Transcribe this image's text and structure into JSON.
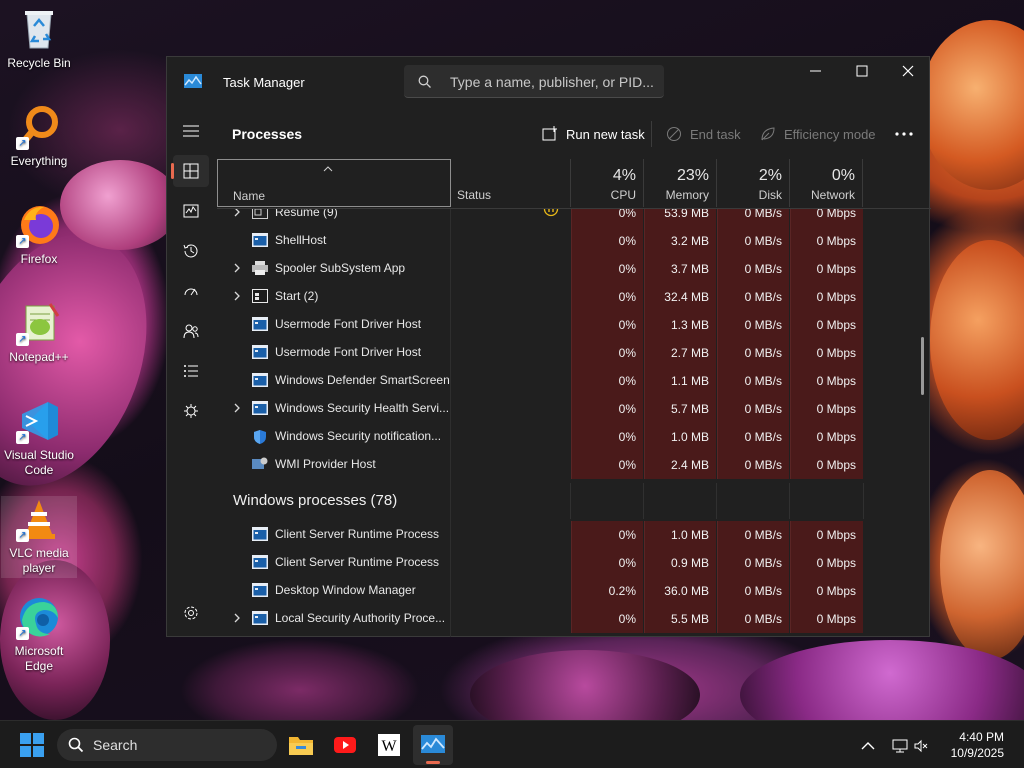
{
  "desktop": {
    "icons": [
      {
        "label": "Recycle Bin",
        "icon": "recycle-bin-icon"
      },
      {
        "label": "Everything",
        "icon": "everything-search-icon"
      },
      {
        "label": "Firefox",
        "icon": "firefox-icon"
      },
      {
        "label": "Notepad++",
        "icon": "notepadpp-icon"
      },
      {
        "label": "Visual Studio Code",
        "icon": "vscode-icon"
      },
      {
        "label": "VLC media player",
        "icon": "vlc-icon"
      },
      {
        "label": "Microsoft Edge",
        "icon": "edge-icon"
      }
    ]
  },
  "window": {
    "title": "Task Manager",
    "search_placeholder": "Type a name, publisher, or PID...",
    "controls": [
      "minimize",
      "maximize",
      "close"
    ]
  },
  "nav": {
    "items": [
      {
        "name": "menu",
        "icon": "hamburger-icon"
      },
      {
        "name": "processes",
        "icon": "processes-icon",
        "active": true
      },
      {
        "name": "performance",
        "icon": "performance-icon"
      },
      {
        "name": "app-history",
        "icon": "history-icon"
      },
      {
        "name": "startup-apps",
        "icon": "startup-icon"
      },
      {
        "name": "users",
        "icon": "users-icon"
      },
      {
        "name": "details",
        "icon": "details-icon"
      },
      {
        "name": "services",
        "icon": "services-icon"
      },
      {
        "name": "settings",
        "icon": "settings-icon"
      }
    ]
  },
  "toolbar": {
    "page_title": "Processes",
    "run_new_task": "Run new task",
    "end_task": "End task",
    "efficiency_mode": "Efficiency mode",
    "more": "..."
  },
  "columns": {
    "name": "Name",
    "status": "Status",
    "cpu": {
      "pct": "4%",
      "label": "CPU"
    },
    "memory": {
      "pct": "23%",
      "label": "Memory"
    },
    "disk": {
      "pct": "2%",
      "label": "Disk"
    },
    "network": {
      "pct": "0%",
      "label": "Network"
    }
  },
  "rows": [
    {
      "name": "Resume (9)",
      "expandable": true,
      "status_icon": "paused",
      "cpu": "0%",
      "memory": "53.9 MB",
      "disk": "0 MB/s",
      "network": "0 Mbps"
    },
    {
      "name": "ShellHost",
      "expandable": false,
      "cpu": "0%",
      "memory": "3.2 MB",
      "disk": "0 MB/s",
      "network": "0 Mbps"
    },
    {
      "name": "Spooler SubSystem App",
      "expandable": true,
      "cpu": "0%",
      "memory": "3.7 MB",
      "disk": "0 MB/s",
      "network": "0 Mbps"
    },
    {
      "name": "Start (2)",
      "expandable": true,
      "cpu": "0%",
      "memory": "32.4 MB",
      "disk": "0 MB/s",
      "network": "0 Mbps"
    },
    {
      "name": "Usermode Font Driver Host",
      "expandable": false,
      "cpu": "0%",
      "memory": "1.3 MB",
      "disk": "0 MB/s",
      "network": "0 Mbps"
    },
    {
      "name": "Usermode Font Driver Host",
      "expandable": false,
      "cpu": "0%",
      "memory": "2.7 MB",
      "disk": "0 MB/s",
      "network": "0 Mbps"
    },
    {
      "name": "Windows Defender SmartScreen",
      "expandable": false,
      "cpu": "0%",
      "memory": "1.1 MB",
      "disk": "0 MB/s",
      "network": "0 Mbps"
    },
    {
      "name": "Windows Security Health Servi...",
      "expandable": true,
      "cpu": "0%",
      "memory": "5.7 MB",
      "disk": "0 MB/s",
      "network": "0 Mbps"
    },
    {
      "name": "Windows Security notification...",
      "expandable": false,
      "cpu": "0%",
      "memory": "1.0 MB",
      "disk": "0 MB/s",
      "network": "0 Mbps"
    },
    {
      "name": "WMI Provider Host",
      "expandable": false,
      "cpu": "0%",
      "memory": "2.4 MB",
      "disk": "0 MB/s",
      "network": "0 Mbps"
    }
  ],
  "group": {
    "label": "Windows processes (78)"
  },
  "group_rows": [
    {
      "name": "Client Server Runtime Process",
      "expandable": false,
      "cpu": "0%",
      "memory": "1.0 MB",
      "disk": "0 MB/s",
      "network": "0 Mbps"
    },
    {
      "name": "Client Server Runtime Process",
      "expandable": false,
      "cpu": "0%",
      "memory": "0.9 MB",
      "disk": "0 MB/s",
      "network": "0 Mbps"
    },
    {
      "name": "Desktop Window Manager",
      "expandable": false,
      "cpu": "0.2%",
      "memory": "36.0 MB",
      "disk": "0 MB/s",
      "network": "0 Mbps"
    },
    {
      "name": "Local Security Authority Proce...",
      "expandable": true,
      "cpu": "0%",
      "memory": "5.5 MB",
      "disk": "0 MB/s",
      "network": "0 Mbps"
    }
  ],
  "taskbar": {
    "search_label": "Search",
    "apps": [
      "file-explorer-icon",
      "youtube-icon",
      "wikipedia-icon",
      "task-manager-icon"
    ],
    "time": "4:40 PM",
    "date": "10/9/2025"
  },
  "colors": {
    "accent": "#e86a4f",
    "heat": "#4a1a1a"
  }
}
